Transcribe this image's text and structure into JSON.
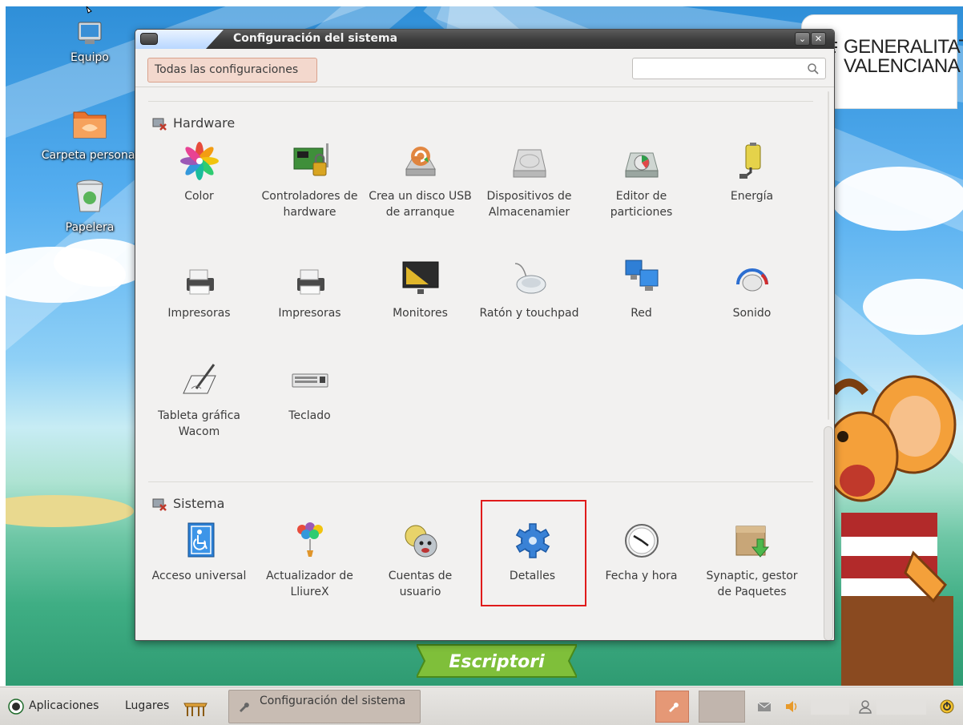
{
  "desktop": {
    "icons": [
      {
        "label": "Equipo"
      },
      {
        "label": "Carpeta personal"
      },
      {
        "label": "Papelera"
      }
    ],
    "logo": {
      "line1": "GENERALITAT",
      "line2": "VALENCIANA"
    },
    "banner": "Escriptori"
  },
  "window": {
    "title": "Configuración del sistema",
    "all_settings_label": "Todas las configuraciones",
    "search": {
      "value": "",
      "placeholder": ""
    },
    "sections": [
      {
        "title": "Hardware",
        "items": [
          {
            "label": "Color",
            "icon": "color-flower-icon"
          },
          {
            "label": "Controladores de hardware",
            "icon": "hardware-drivers-icon"
          },
          {
            "label": "Crea un disco USB de arranque",
            "icon": "usb-startup-disk-icon"
          },
          {
            "label": "Dispositivos de Almacenamier",
            "icon": "storage-devices-icon"
          },
          {
            "label": "Editor de particiones",
            "icon": "partition-editor-icon"
          },
          {
            "label": "Energía",
            "icon": "power-battery-icon"
          },
          {
            "label": "Impresoras",
            "icon": "printer-icon"
          },
          {
            "label": "Impresoras",
            "icon": "printer-icon"
          },
          {
            "label": "Monitores",
            "icon": "monitor-icon"
          },
          {
            "label": "Ratón y touchpad",
            "icon": "mouse-icon"
          },
          {
            "label": "Red",
            "icon": "network-icon"
          },
          {
            "label": "Sonido",
            "icon": "sound-knob-icon"
          },
          {
            "label": "Tableta gráfica Wacom",
            "icon": "wacom-tablet-icon"
          },
          {
            "label": "Teclado",
            "icon": "keyboard-icon"
          }
        ]
      },
      {
        "title": "Sistema",
        "items": [
          {
            "label": "Acceso universal",
            "icon": "universal-access-icon"
          },
          {
            "label": "Actualizador de LliureX",
            "icon": "updater-balloons-icon"
          },
          {
            "label": "Cuentas de usuario",
            "icon": "user-accounts-icon"
          },
          {
            "label": "Detalles",
            "icon": "details-gear-icon"
          },
          {
            "label": "Fecha y hora",
            "icon": "clock-icon"
          },
          {
            "label": "Synaptic, gestor de Paquetes",
            "icon": "synaptic-package-icon"
          }
        ]
      }
    ]
  },
  "taskbar": {
    "applications_label": "Aplicaciones",
    "places_label": "Lugares",
    "task_label": "Configuración del sistema"
  },
  "colors": {
    "highlight": "#e01b1b",
    "accent_button": "#f3d8cd",
    "active_tray": "#e59876"
  }
}
